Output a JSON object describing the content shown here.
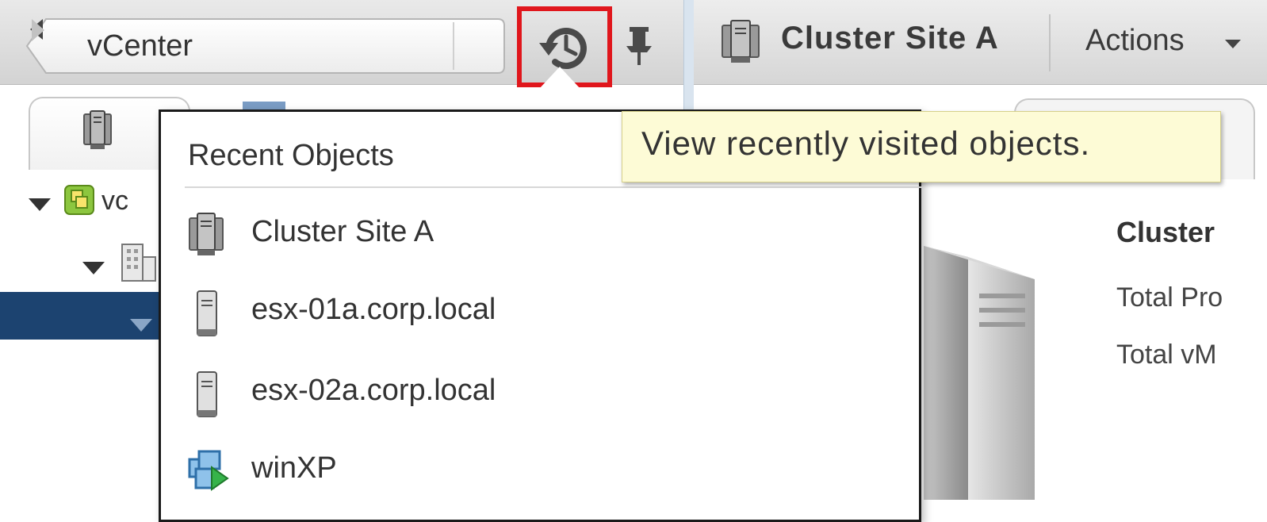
{
  "breadcrumb": {
    "label": "vCenter"
  },
  "tree": {
    "row1_label": "vc"
  },
  "object_header": {
    "title": "Cluster Site A",
    "actions_label": "Actions"
  },
  "summary": {
    "title": "Cluster",
    "line1": "Total Pro",
    "line2": "Total vM"
  },
  "recent_objects": {
    "title": "Recent Objects",
    "items": [
      {
        "label": "Cluster Site A",
        "icon": "cluster-icon"
      },
      {
        "label": "esx-01a.corp.local",
        "icon": "host-icon"
      },
      {
        "label": "esx-02a.corp.local",
        "icon": "host-icon"
      },
      {
        "label": "winXP",
        "icon": "vm-icon"
      }
    ]
  },
  "tooltip": {
    "text": "View recently visited objects."
  },
  "colors": {
    "highlight_border": "#e0161c",
    "selection": "#1c4370",
    "tooltip_bg": "#fdfbd6"
  }
}
